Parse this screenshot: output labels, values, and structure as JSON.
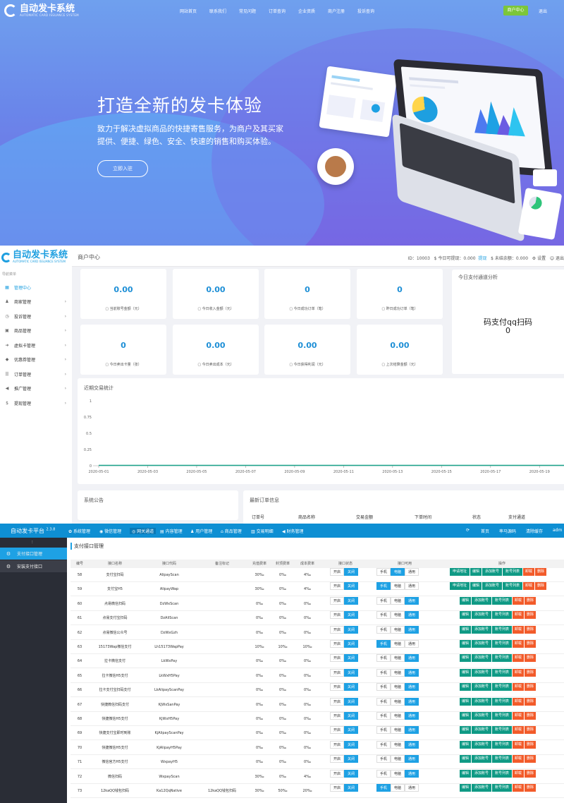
{
  "landing": {
    "logo_title": "自动发卡系统",
    "logo_subtitle": "AUTOMATIC CARD ISSUANCE SYSTEM",
    "nav": [
      "网站首页",
      "联系我们",
      "常见问题",
      "订单查询",
      "企业资质",
      "商户注册",
      "投诉查询"
    ],
    "merchant_center": "商户中心",
    "logout": "退出",
    "hero_title": "打造全新的发卡体验",
    "hero_desc": "致力于解决虚拟商品的快捷寄售服务，为商户及其买家 提供、便捷、绿色、安全、快速的销售和购买体验。",
    "join_button": "立即入驻"
  },
  "merchant": {
    "logo_title": "自动发卡系统",
    "logo_subtitle": "AUTOMATIC CARD ISSUANCE SYSTEM",
    "nav_label": "导航菜单",
    "sidebar": [
      {
        "label": "管理中心",
        "icon": "grid-icon",
        "active": true,
        "arrow": false
      },
      {
        "label": "商家管理",
        "icon": "user-icon",
        "arrow": true
      },
      {
        "label": "投诉管理",
        "icon": "clock-icon",
        "arrow": true
      },
      {
        "label": "商品管理",
        "icon": "box-icon",
        "arrow": true
      },
      {
        "label": "虚拟卡管理",
        "icon": "arrow-icon",
        "arrow": true
      },
      {
        "label": "优惠券管理",
        "icon": "tag-icon",
        "arrow": true
      },
      {
        "label": "订单管理",
        "icon": "list-icon",
        "arrow": true
      },
      {
        "label": "推广管理",
        "icon": "megaphone-icon",
        "arrow": true
      },
      {
        "label": "提现管理",
        "icon": "dollar-icon",
        "arrow": true
      }
    ],
    "header_title": "商户中心",
    "header_id_label": "ID：",
    "header_id": "10003",
    "header_withdrawable_label": "$ 今日可提现：",
    "header_withdrawable": "0.000",
    "header_withdraw_link": "提现",
    "header_unsettled_label": "$ 未结余额：",
    "header_unsettled": "0.000",
    "header_settings": "⚙ 设置",
    "header_exit": "☺ 退出",
    "stats": [
      {
        "value": "0.00",
        "label": "当前账号金额（元）",
        "icon": "wallet-icon"
      },
      {
        "value": "0.00",
        "label": "今日收入金额（元）",
        "icon": "coin-icon"
      },
      {
        "value": "0",
        "label": "今日成功订单（笔）",
        "icon": "order-icon"
      },
      {
        "value": "0",
        "label": "昨日成功订单（笔）",
        "icon": "order-icon"
      },
      {
        "value": "0",
        "label": "今日卖出卡量（张）",
        "icon": "card-icon"
      },
      {
        "value": "0.00",
        "label": "今日卖出成本（元）",
        "icon": "database-icon"
      },
      {
        "value": "0.00",
        "label": "今日获得利润（元）",
        "icon": "chart-icon"
      },
      {
        "value": "0.00",
        "label": "上次结算金额（元）",
        "icon": "settle-icon"
      }
    ],
    "analysis_title": "今日支付通道分析",
    "analysis_channel": "码支付qq扫码",
    "analysis_value": "0",
    "chart_title": "近期交易统计",
    "notice_title": "系统公告",
    "orders_title": "最新订单信息",
    "orders_columns": [
      "订单号",
      "商品名称",
      "交易金额",
      "下单时间",
      "状态",
      "支付通道"
    ]
  },
  "chart_data": {
    "type": "line",
    "title": "近期交易统计",
    "x": [
      "2020-05-01",
      "2020-05-02",
      "2020-05-03",
      "2020-05-04",
      "2020-05-05",
      "2020-05-06",
      "2020-05-07",
      "2020-05-08",
      "2020-05-09",
      "2020-05-10",
      "2020-05-11",
      "2020-05-12",
      "2020-05-13",
      "2020-05-14",
      "2020-05-15",
      "2020-05-16",
      "2020-05-17",
      "2020-05-18",
      "2020-05-19",
      "2020-05-20"
    ],
    "x_tick_labels": [
      "2020-05-01",
      "2020-05-03",
      "2020-05-05",
      "2020-05-07",
      "2020-05-09",
      "2020-05-11",
      "2020-05-13",
      "2020-05-15",
      "2020-05-17",
      "2020-05-19"
    ],
    "series": [
      {
        "values": [
          0,
          0,
          0,
          0,
          0,
          0,
          0,
          0,
          0,
          0,
          0,
          0,
          0,
          0,
          0,
          0,
          0,
          0,
          0,
          0
        ],
        "color": "#19a38a"
      }
    ],
    "y_ticks": [
      "1",
      "0.75",
      "0.5",
      "0.25",
      "0"
    ],
    "ylim": [
      0,
      1
    ],
    "grid": true
  },
  "admin": {
    "brand": "自动发卡平台",
    "version": "2.3.8",
    "menu": [
      {
        "label": "系统管理",
        "icon": "gear-icon"
      },
      {
        "label": "微信管理",
        "icon": "wechat-icon"
      },
      {
        "label": "网关通道",
        "icon": "gateway-icon",
        "active": true
      },
      {
        "label": "内容管理",
        "icon": "doc-icon"
      },
      {
        "label": "用户管理",
        "icon": "users-icon"
      },
      {
        "label": "商品管理",
        "icon": "shop-icon"
      },
      {
        "label": "交易明细",
        "icon": "bar-icon"
      },
      {
        "label": "财务管理",
        "icon": "send-icon"
      }
    ],
    "right_links": [
      "首页",
      "率马源码",
      "清除缓存",
      "adm"
    ],
    "sidebar_toggle": "⫶",
    "sidebar": [
      {
        "label": "支付接口管理",
        "icon": "gear-icon",
        "active": true
      },
      {
        "label": "安装支付接口",
        "icon": "gear-icon"
      }
    ],
    "page_title": "支付接口管理",
    "columns": [
      "编号",
      "接口名称",
      "接口代码",
      "备注标记",
      "充值费率",
      "封顶费率",
      "成本费率",
      "接口状态",
      "接口可用",
      "操作"
    ],
    "buttons": {
      "on": "开启",
      "off": "关闭",
      "mobile": "手机",
      "pc": "电脑",
      "both": "通用",
      "apply": "申请地址",
      "edit": "编辑",
      "add_acct": "添加账号",
      "acct_list": "账号列表",
      "uninstall": "卸载",
      "delete": "删除"
    },
    "rows": [
      {
        "id": "58",
        "name": "支付宝扫码",
        "code": "AlipayScan",
        "note": "",
        "rate": "30‰",
        "cap": "0‰",
        "cost": "4‰",
        "avail": "pc",
        "apply": true
      },
      {
        "id": "59",
        "name": "支付宝H5",
        "code": "AlipayWap",
        "note": "",
        "rate": "30‰",
        "cap": "0‰",
        "cost": "4‰",
        "avail": "mobile",
        "apply": true
      },
      {
        "id": "60",
        "name": "点易微信扫码",
        "code": "DzWxScan",
        "note": "",
        "rate": "0‰",
        "cap": "0‰",
        "cost": "0‰",
        "avail": "both",
        "apply": false
      },
      {
        "id": "61",
        "name": "点易支付宝扫码",
        "code": "DzAliScan",
        "note": "",
        "rate": "0‰",
        "cap": "0‰",
        "cost": "0‰",
        "avail": "both",
        "apply": false
      },
      {
        "id": "62",
        "name": "点易微信公众号",
        "code": "DzWxGzh",
        "note": "",
        "rate": "0‰",
        "cap": "0‰",
        "cost": "0‰",
        "avail": "both",
        "apply": false
      },
      {
        "id": "63",
        "name": "15173Wap微信支付",
        "code": "Lh15173WapPay",
        "note": "",
        "rate": "10‰",
        "cap": "10‰",
        "cost": "10‰",
        "avail": "mobile",
        "apply": false
      },
      {
        "id": "64",
        "name": "拉卡微信支付",
        "code": "LkWxPay",
        "note": "",
        "rate": "0‰",
        "cap": "0‰",
        "cost": "0‰",
        "avail": "both",
        "apply": false
      },
      {
        "id": "65",
        "name": "拉卡微信H5支付",
        "code": "LkWxH5Pay",
        "note": "",
        "rate": "0‰",
        "cap": "0‰",
        "cost": "0‰",
        "avail": "both",
        "apply": false
      },
      {
        "id": "66",
        "name": "拉卡支付宝扫码支付",
        "code": "LkAlipayScanPay",
        "note": "",
        "rate": "0‰",
        "cap": "0‰",
        "cost": "0‰",
        "avail": "both",
        "apply": false
      },
      {
        "id": "67",
        "name": "快捷微信扫码支付",
        "code": "KjWxSanPay",
        "note": "",
        "rate": "0‰",
        "cap": "0‰",
        "cost": "0‰",
        "avail": "both",
        "apply": false
      },
      {
        "id": "68",
        "name": "快捷微信H5支付",
        "code": "KjWxH5Pay",
        "note": "",
        "rate": "0‰",
        "cap": "0‰",
        "cost": "0‰",
        "avail": "both",
        "apply": false
      },
      {
        "id": "69",
        "name": "快捷支付宝即时到账",
        "code": "KjAlipayScanPay",
        "note": "",
        "rate": "0‰",
        "cap": "0‰",
        "cost": "0‰",
        "avail": "both",
        "apply": false
      },
      {
        "id": "70",
        "name": "快捷微信H5支付",
        "code": "KjAlipayH5Pay",
        "note": "",
        "rate": "0‰",
        "cap": "0‰",
        "cost": "0‰",
        "avail": "both",
        "apply": false
      },
      {
        "id": "71",
        "name": "微信官方H5支付",
        "code": "WxpayH5",
        "note": "",
        "rate": "0‰",
        "cap": "0‰",
        "cost": "0‰",
        "avail": "both",
        "apply": false
      },
      {
        "id": "72",
        "name": "微信扫码",
        "code": "WxpayScan",
        "note": "",
        "rate": "30‰",
        "cap": "0‰",
        "cost": "4‰",
        "avail": "both",
        "apply": false
      },
      {
        "id": "73",
        "name": "12kaQQ钱包扫码",
        "code": "Ka12QqNative",
        "note": "12kaQQ钱包扫码",
        "rate": "30‰",
        "cap": "50‰",
        "cost": "20‰",
        "avail": "mobile",
        "apply": false
      }
    ]
  }
}
